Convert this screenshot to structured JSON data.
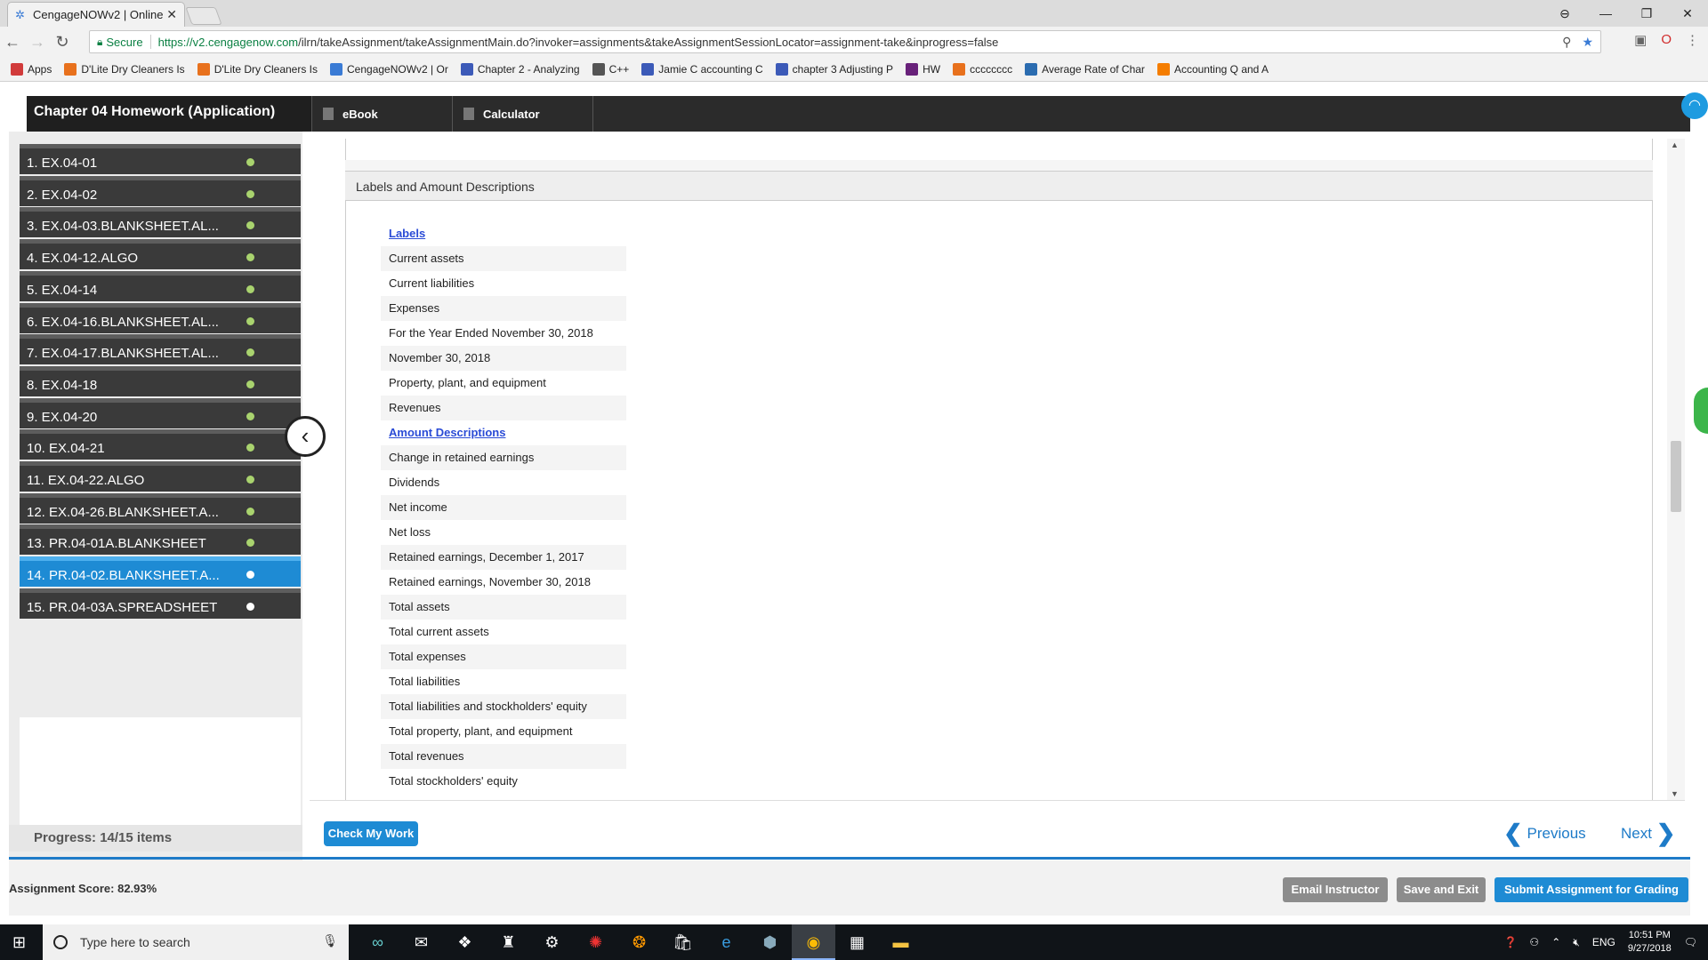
{
  "browser": {
    "tab_title": "CengageNOWv2 | Online",
    "tab_close": "✕",
    "window_controls": [
      "⊖",
      "—",
      "❐",
      "✕"
    ],
    "secure_label": "Secure",
    "url_host": "https://v2.cengagenow.com",
    "url_path": "/ilrn/takeAssignment/takeAssignmentMain.do?invoker=assignments&takeAssignmentSessionLocator=assignment-take&inprogress=false",
    "bookmarks": [
      {
        "label": "Apps",
        "icon": "apps-icon",
        "color": "#d13b3b"
      },
      {
        "label": "D'Lite Dry Cleaners Is",
        "icon": "cengage-icon",
        "color": "#e8711d"
      },
      {
        "label": "D'Lite Dry Cleaners Is",
        "icon": "cengage-icon",
        "color": "#e8711d"
      },
      {
        "label": "CengageNOWv2 | Or",
        "icon": "cengagenow-icon",
        "color": "#3a7bd5"
      },
      {
        "label": "Chapter 2 - Analyzing",
        "icon": "quizlet-icon",
        "color": "#3c5ab8"
      },
      {
        "label": "C++",
        "icon": "cpp-icon",
        "color": "#555555"
      },
      {
        "label": "Jamie C accounting C",
        "icon": "quizlet-icon",
        "color": "#3c5ab8"
      },
      {
        "label": "chapter 3 Adjusting P",
        "icon": "quizlet-icon",
        "color": "#3c5ab8"
      },
      {
        "label": "HW",
        "icon": "vs-icon",
        "color": "#68217a"
      },
      {
        "label": "cccccccc",
        "icon": "cengage-icon",
        "color": "#e8711d"
      },
      {
        "label": "Average Rate of Char",
        "icon": "mathway-icon",
        "color": "#2b6cb0"
      },
      {
        "label": "Accounting Q and A",
        "icon": "blogger-icon",
        "color": "#f57d00"
      }
    ]
  },
  "header": {
    "assignment_title": "Chapter 04 Homework (Application)",
    "ebook_label": "eBook",
    "calculator_label": "Calculator"
  },
  "sidebar": {
    "items": [
      {
        "label": "1. EX.04-01",
        "status": "complete"
      },
      {
        "label": "2. EX.04-02",
        "status": "complete"
      },
      {
        "label": "3. EX.04-03.BLANKSHEET.AL...",
        "status": "complete"
      },
      {
        "label": "4. EX.04-12.ALGO",
        "status": "complete"
      },
      {
        "label": "5. EX.04-14",
        "status": "complete"
      },
      {
        "label": "6. EX.04-16.BLANKSHEET.AL...",
        "status": "complete"
      },
      {
        "label": "7. EX.04-17.BLANKSHEET.AL...",
        "status": "complete"
      },
      {
        "label": "8. EX.04-18",
        "status": "complete"
      },
      {
        "label": "9. EX.04-20",
        "status": "complete"
      },
      {
        "label": "10. EX.04-21",
        "status": "complete"
      },
      {
        "label": "11. EX.04-22.ALGO",
        "status": "complete"
      },
      {
        "label": "12. EX.04-26.BLANKSHEET.A...",
        "status": "complete"
      },
      {
        "label": "13. PR.04-01A.BLANKSHEET",
        "status": "complete"
      },
      {
        "label": "14. PR.04-02.BLANKSHEET.A...",
        "status": "active"
      },
      {
        "label": "15. PR.04-03A.SPREADSHEET",
        "status": "pending"
      }
    ],
    "progress": "Progress:  14/15 items"
  },
  "main": {
    "section_title": "Labels and Amount Descriptions",
    "labels_heading": "Labels",
    "labels": [
      "Current assets",
      "Current liabilities",
      "Expenses",
      "For the Year Ended November 30, 2018",
      "November 30, 2018",
      "Property, plant, and equipment",
      "Revenues"
    ],
    "amounts_heading": "Amount Descriptions",
    "amounts": [
      "Change in retained earnings",
      "Dividends",
      "Net income",
      "Net loss",
      "Retained earnings, December 1, 2017",
      "Retained earnings, November 30, 2018",
      "Total assets",
      "Total current assets",
      "Total expenses",
      "Total liabilities",
      "Total liabilities and stockholders' equity",
      "Total property, plant, and equipment",
      "Total revenues",
      "Total stockholders' equity"
    ]
  },
  "nav": {
    "check_label": "Check My Work",
    "previous_label": "Previous",
    "next_label": "Next"
  },
  "footer": {
    "score": "Assignment Score: 82.93%",
    "email_label": "Email Instructor",
    "save_label": "Save and Exit",
    "submit_label": "Submit Assignment for Grading"
  },
  "taskbar": {
    "search_placeholder": "Type here to search",
    "language": "ENG",
    "time": "10:51 PM",
    "date": "9/27/2018"
  },
  "colors": {
    "accent_blue": "#1e8bd4",
    "complete_dot": "#a9d36e",
    "link_blue": "#2a4bd6"
  }
}
